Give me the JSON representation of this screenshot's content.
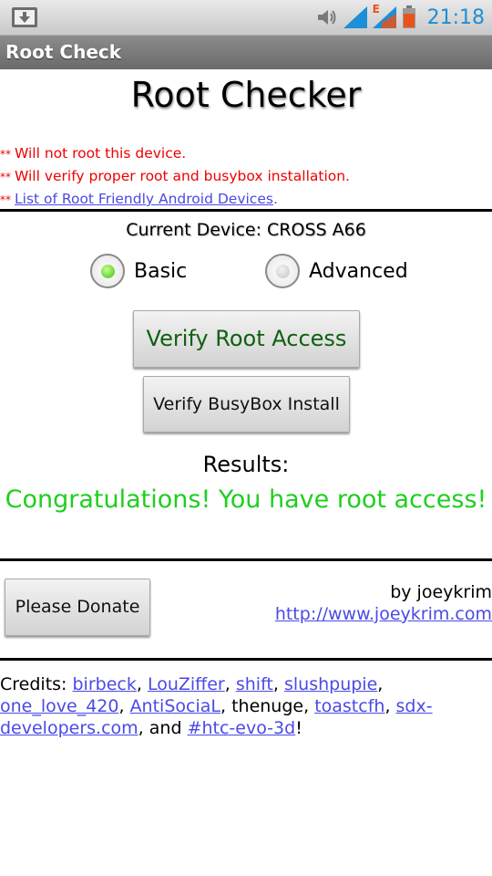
{
  "status_bar": {
    "clock": "21:18",
    "network_badge": "E",
    "icons": [
      "download-icon",
      "volume-icon",
      "signal-icon",
      "signal-e-icon",
      "battery-icon"
    ],
    "colors": {
      "accent": "#1c8fd6",
      "battery": "#e8541c"
    }
  },
  "app": {
    "title": "Root Check"
  },
  "header": {
    "heading": "Root Checker"
  },
  "notes": {
    "bullet": "**",
    "line1": "Will not root this device.",
    "line2": "Will verify proper root and busybox installation.",
    "link": "List of Root Friendly Android Devices",
    "link_suffix": "."
  },
  "device": {
    "label": "Current Device: CROSS A66"
  },
  "mode": {
    "basic_label": "Basic",
    "advanced_label": "Advanced",
    "selected": "Basic"
  },
  "buttons": {
    "verify_root": "Verify Root Access",
    "verify_busybox": "Verify BusyBox Install",
    "donate": "Please Donate"
  },
  "results": {
    "label": "Results:",
    "message": "Congratulations! You have root access!"
  },
  "author": {
    "by": "by joeykrim",
    "site": "http://www.joeykrim.com"
  },
  "credits": {
    "prefix": "Credits: ",
    "names": [
      "birbeck",
      "LouZiffer",
      "shift",
      "slushpupie",
      "one_love_420",
      "AntiSociaL"
    ],
    "plain_name": "thenuge",
    "names2": [
      "toastcfh",
      "sdx-developers.com"
    ],
    "and": "and",
    "last": "#htc-evo-3d",
    "end": "!"
  },
  "colors": {
    "link": "#4a4ae6",
    "warning": "#ee0000",
    "success": "#1fcf1f",
    "root_button_text": "#106010"
  }
}
